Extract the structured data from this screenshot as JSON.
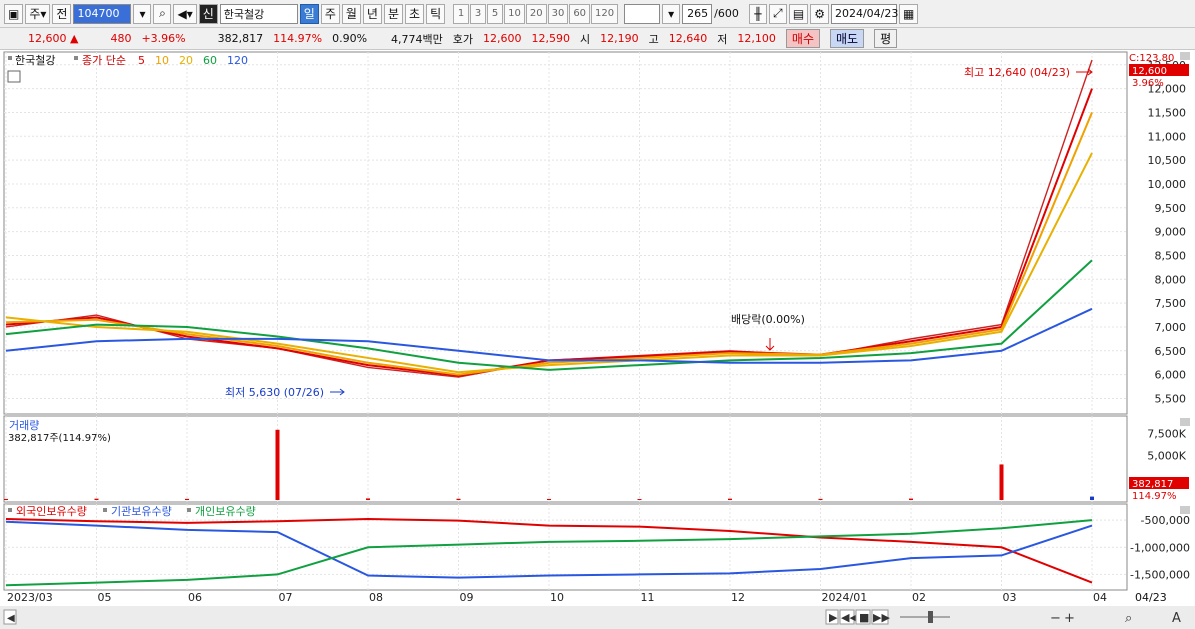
{
  "toolbar": {
    "type_label": "주",
    "prev_label": "전",
    "code": "104700",
    "stock_name": "한국철강",
    "new_badge": "신",
    "period_tabs": [
      "일",
      "주",
      "월",
      "년",
      "분",
      "초",
      "틱"
    ],
    "active_period": "일",
    "interval_buttons": [
      "1",
      "3",
      "5",
      "10",
      "20",
      "30",
      "60",
      "120"
    ],
    "count": "265",
    "count_max": "/600",
    "date": "2024/04/23"
  },
  "quote": {
    "price": "12,600",
    "arrow": "▲",
    "change": "480",
    "change_pct": "+3.96%",
    "volume": "382,817",
    "vol_ratio": "114.97%",
    "turnover_pct": "0.90%",
    "amount": "4,774백만",
    "hoga_label": "호가",
    "ask": "12,600",
    "bid": "12,590",
    "open_label": "시",
    "open": "12,190",
    "high_label": "고",
    "high": "12,640",
    "low_label": "저",
    "low": "12,100",
    "buy_label": "매수",
    "sell_label": "매도",
    "eval_label": "평"
  },
  "price_legend": {
    "name": "한국철강",
    "series_label": "종가 단순",
    "ma": [
      {
        "label": "5",
        "color": "#e00000"
      },
      {
        "label": "10",
        "color": "#f0a000"
      },
      {
        "label": "20",
        "color": "#e8b000"
      },
      {
        "label": "60",
        "color": "#10a040"
      },
      {
        "label": "120",
        "color": "#2a57e0"
      }
    ]
  },
  "volume_panel": {
    "title": "거래량",
    "value": "382,817주(114.97%)",
    "last_tag": "382,817",
    "pct_tag": "114.97%"
  },
  "holdings_legend": {
    "items": [
      {
        "label": "외국인보유수량",
        "color": "#e00000"
      },
      {
        "label": "기관보유수량",
        "color": "#2a57e0"
      },
      {
        "label": "개인보유수량",
        "color": "#10a040"
      }
    ]
  },
  "annotations": {
    "high": "최고 12,640 (04/23)",
    "low": "최저 5,630 (07/26)",
    "dividend": "배당락(0.00%)",
    "cur_label": "C:123.80",
    "cur_price": "12,600",
    "cur_pct": "3.96%"
  },
  "bottom_date": "04/23",
  "chart_data": [
    {
      "type": "line",
      "title": "한국철강",
      "ylim": [
        5300,
        12600
      ],
      "y_ticks": [
        "5,500",
        "6,000",
        "6,500",
        "7,000",
        "7,500",
        "8,000",
        "8,500",
        "9,000",
        "9,500",
        "10,000",
        "10,500",
        "11,000",
        "11,500",
        "12,000",
        "12,500"
      ],
      "x": [
        "2023/03",
        "05",
        "06",
        "07",
        "08",
        "09",
        "10",
        "11",
        "12",
        "2024/01",
        "02",
        "03",
        "04"
      ],
      "series": [
        {
          "name": "종가",
          "color": "#cc2222",
          "values": [
            7000,
            7250,
            6750,
            6550,
            6150,
            5950,
            6300,
            6400,
            6500,
            6400,
            6750,
            7050,
            12600
          ]
        },
        {
          "name": "5",
          "color": "#e00000",
          "values": [
            7050,
            7200,
            6800,
            6550,
            6200,
            5980,
            6300,
            6380,
            6480,
            6420,
            6700,
            7000,
            12000
          ]
        },
        {
          "name": "10",
          "color": "#f0a000",
          "values": [
            7100,
            7150,
            6850,
            6600,
            6250,
            6000,
            6250,
            6350,
            6450,
            6420,
            6650,
            6950,
            11500
          ]
        },
        {
          "name": "20",
          "color": "#e8b000",
          "values": [
            7200,
            7000,
            6900,
            6650,
            6350,
            6050,
            6200,
            6300,
            6400,
            6400,
            6600,
            6900,
            10650
          ]
        },
        {
          "name": "60",
          "color": "#10a040",
          "values": [
            6850,
            7050,
            7000,
            6800,
            6550,
            6250,
            6100,
            6200,
            6300,
            6350,
            6450,
            6650,
            8400
          ]
        },
        {
          "name": "120",
          "color": "#2a57e0",
          "values": [
            6500,
            6700,
            6750,
            6750,
            6700,
            6500,
            6300,
            6300,
            6250,
            6250,
            6300,
            6500,
            7380
          ]
        }
      ]
    },
    {
      "type": "bar",
      "title": "거래량",
      "y_ticks": [
        "7,500K",
        "5,000K"
      ],
      "ylim": [
        0,
        9000
      ],
      "categories": [
        "2023/03",
        "05",
        "06",
        "07",
        "08",
        "09",
        "10",
        "11",
        "12",
        "2024/01",
        "02",
        "03",
        "04"
      ],
      "values": [
        120,
        150,
        130,
        7900,
        180,
        140,
        120,
        110,
        150,
        130,
        160,
        4000,
        382
      ]
    },
    {
      "type": "line",
      "title": "보유수량",
      "y_ticks": [
        "-500,000",
        "-1,000,000",
        "-1,500,000"
      ],
      "ylim": [
        -1750000,
        -350000
      ],
      "x": [
        "2023/03",
        "05",
        "06",
        "07",
        "08",
        "09",
        "10",
        "11",
        "12",
        "2024/01",
        "02",
        "03",
        "04"
      ],
      "series": [
        {
          "name": "외국인보유수량",
          "color": "#e00000",
          "values": [
            -480000,
            -520000,
            -550000,
            -520000,
            -480000,
            -510000,
            -600000,
            -620000,
            -700000,
            -820000,
            -900000,
            -1000000,
            -1650000
          ]
        },
        {
          "name": "기관보유수량",
          "color": "#2a57e0",
          "values": [
            -530000,
            -600000,
            -680000,
            -720000,
            -1520000,
            -1560000,
            -1520000,
            -1500000,
            -1480000,
            -1400000,
            -1200000,
            -1150000,
            -600000
          ]
        },
        {
          "name": "개인보유수량",
          "color": "#10a040",
          "values": [
            -1700000,
            -1650000,
            -1600000,
            -1500000,
            -1000000,
            -950000,
            -900000,
            -880000,
            -850000,
            -800000,
            -750000,
            -650000,
            -500000
          ]
        }
      ]
    }
  ]
}
